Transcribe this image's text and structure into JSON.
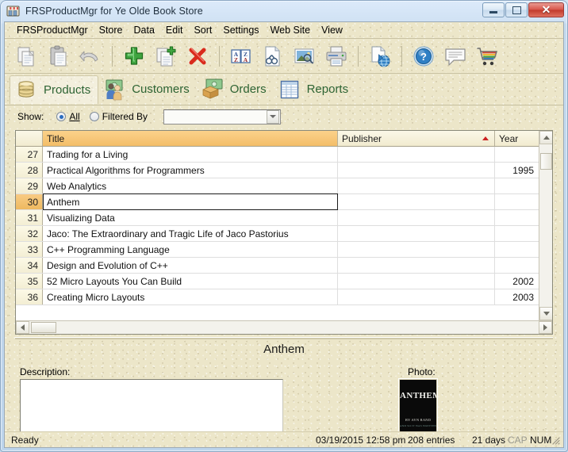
{
  "window": {
    "title": "FRSProductMgr for Ye Olde Book Store",
    "app_icon": "store-icon",
    "minimize_label": "Minimize",
    "maximize_label": "Maximize",
    "close_label": "Close"
  },
  "menu": {
    "items": [
      {
        "label": "FRSProductMgr",
        "name": "menu-frsproductmgr"
      },
      {
        "label": "Store",
        "name": "menu-store"
      },
      {
        "label": "Data",
        "name": "menu-data"
      },
      {
        "label": "Edit",
        "name": "menu-edit"
      },
      {
        "label": "Sort",
        "name": "menu-sort"
      },
      {
        "label": "Settings",
        "name": "menu-settings"
      },
      {
        "label": "Web Site",
        "name": "menu-web-site"
      },
      {
        "label": "View",
        "name": "menu-view"
      }
    ]
  },
  "toolbar": {
    "buttons": [
      {
        "icon": "copy-icon",
        "label": "Copy",
        "enabled": false
      },
      {
        "icon": "paste-icon",
        "label": "Paste",
        "enabled": false
      },
      {
        "icon": "undo-icon",
        "label": "Undo",
        "enabled": false
      },
      {
        "icon": "add-icon",
        "label": "Add",
        "enabled": true
      },
      {
        "icon": "duplicate-icon",
        "label": "Duplicate",
        "enabled": true
      },
      {
        "icon": "delete-icon",
        "label": "Delete",
        "enabled": true
      },
      {
        "icon": "sort-az-icon",
        "label": "Sort",
        "enabled": true
      },
      {
        "icon": "find-icon",
        "label": "Find",
        "enabled": true
      },
      {
        "icon": "preview-image-icon",
        "label": "Preview Image",
        "enabled": true
      },
      {
        "icon": "print-icon",
        "label": "Print",
        "enabled": true
      },
      {
        "icon": "export-web-icon",
        "label": "Export to Web",
        "enabled": true
      },
      {
        "icon": "help-icon",
        "label": "Help",
        "enabled": true
      },
      {
        "icon": "comment-icon",
        "label": "Comments",
        "enabled": true
      },
      {
        "icon": "cart-icon",
        "label": "Cart",
        "enabled": true
      }
    ]
  },
  "tabs": [
    {
      "label": "Products",
      "icon": "database-icon",
      "active": true
    },
    {
      "label": "Customers",
      "icon": "customers-icon",
      "active": false
    },
    {
      "label": "Orders",
      "icon": "orders-icon",
      "active": false
    },
    {
      "label": "Reports",
      "icon": "reports-icon",
      "active": false
    }
  ],
  "filter": {
    "show_label": "Show:",
    "all_label": "All",
    "all_accel": "A",
    "all_selected": true,
    "filtered_label": "Filtered By",
    "filtered_accel": "B",
    "filtered_selected": false,
    "combo_value": "",
    "combo_placeholder": ""
  },
  "grid": {
    "columns": [
      {
        "key": "rownum",
        "label": "",
        "sorted": false
      },
      {
        "key": "title",
        "label": "Title",
        "highlighted": true,
        "sorted": false
      },
      {
        "key": "publisher",
        "label": "Publisher",
        "sorted": true,
        "sort_dir": "asc"
      },
      {
        "key": "year",
        "label": "Year",
        "sorted": false
      }
    ],
    "rows": [
      {
        "num": "27",
        "title": "Trading for a Living",
        "publisher": "",
        "year": "",
        "selected": false
      },
      {
        "num": "28",
        "title": "Practical Algorithms for Programmers",
        "publisher": "",
        "year": "1995",
        "selected": false
      },
      {
        "num": "29",
        "title": "Web Analytics",
        "publisher": "",
        "year": "",
        "selected": false
      },
      {
        "num": "30",
        "title": "Anthem",
        "publisher": "",
        "year": "",
        "selected": true
      },
      {
        "num": "31",
        "title": "Visualizing Data",
        "publisher": "",
        "year": "",
        "selected": false
      },
      {
        "num": "32",
        "title": "Jaco: The Extraordinary and Tragic Life of Jaco Pastorius",
        "publisher": "",
        "year": "",
        "selected": false
      },
      {
        "num": "33",
        "title": "C++ Programming Language",
        "publisher": "",
        "year": "",
        "selected": false
      },
      {
        "num": "34",
        "title": "Design and Evolution of C++",
        "publisher": "",
        "year": "",
        "selected": false
      },
      {
        "num": "35",
        "title": "52 Micro Layouts You Can Build",
        "publisher": "",
        "year": "2002",
        "selected": false
      },
      {
        "num": "36",
        "title": "Creating Micro Layouts",
        "publisher": "",
        "year": "2003",
        "selected": false
      }
    ]
  },
  "detail": {
    "title": "Anthem",
    "description_label": "Description:",
    "description_value": "",
    "photo_label": "Photo:",
    "photo_cover_title": "ANTHEM",
    "photo_cover_sub": "BY AYN RAND",
    "photo_cover_sub2": "AND SO IT WAS WRITTEN"
  },
  "status": {
    "ready": "Ready",
    "datetime": "03/19/2015 12:58 pm",
    "entries": "208 entries",
    "days": "21 days",
    "cap": "CAP",
    "num": "NUM"
  }
}
